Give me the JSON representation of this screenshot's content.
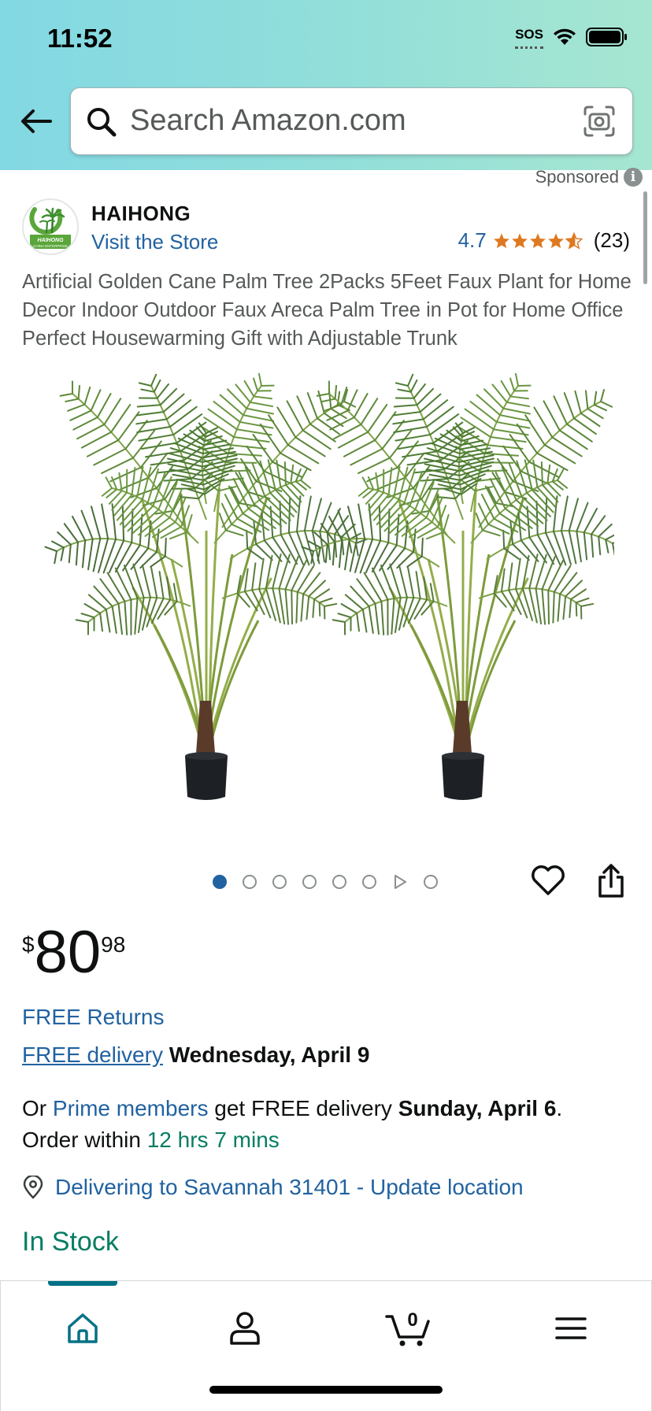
{
  "status_bar": {
    "time": "11:52",
    "sos": "SOS"
  },
  "search": {
    "placeholder": "Search Amazon.com"
  },
  "sponsored": {
    "label": "Sponsored"
  },
  "brand": {
    "name": "HAIHONG",
    "store_link": "Visit the Store",
    "logo_text": "HAIHONG",
    "logo_subtext": "CHINA ENTERPRISE",
    "rating": "4.7",
    "rating_stars": 4.7,
    "review_count": "(23)"
  },
  "product": {
    "title": "Artificial Golden Cane Palm Tree 2Packs 5Feet Faux Plant for Home Decor Indoor Outdoor Faux Areca Palm Tree in Pot for Home Office Perfect Housewarming Gift with Adjustable Trunk",
    "image_count": 8,
    "active_image": 1
  },
  "price": {
    "symbol": "$",
    "whole": "80",
    "fraction": "98"
  },
  "shipping": {
    "free_returns": "FREE Returns",
    "free_delivery_link": "FREE delivery",
    "free_delivery_date": "Wednesday, April 9",
    "prime_prefix": "Or ",
    "prime_link": "Prime members",
    "prime_middle": " get FREE delivery ",
    "prime_date": "Sunday, April 6",
    "prime_suffix": ".",
    "order_within_prefix": "Order within ",
    "order_within_time": "12 hrs 7 mins",
    "location": "Delivering to Savannah 31401 - Update location"
  },
  "stock": {
    "status": "In Stock"
  },
  "bottom_nav": {
    "cart_count": "0",
    "active": "home"
  },
  "colors": {
    "link": "#2162a1",
    "green": "#067d62",
    "star": "#de7921",
    "accent": "#007185"
  }
}
